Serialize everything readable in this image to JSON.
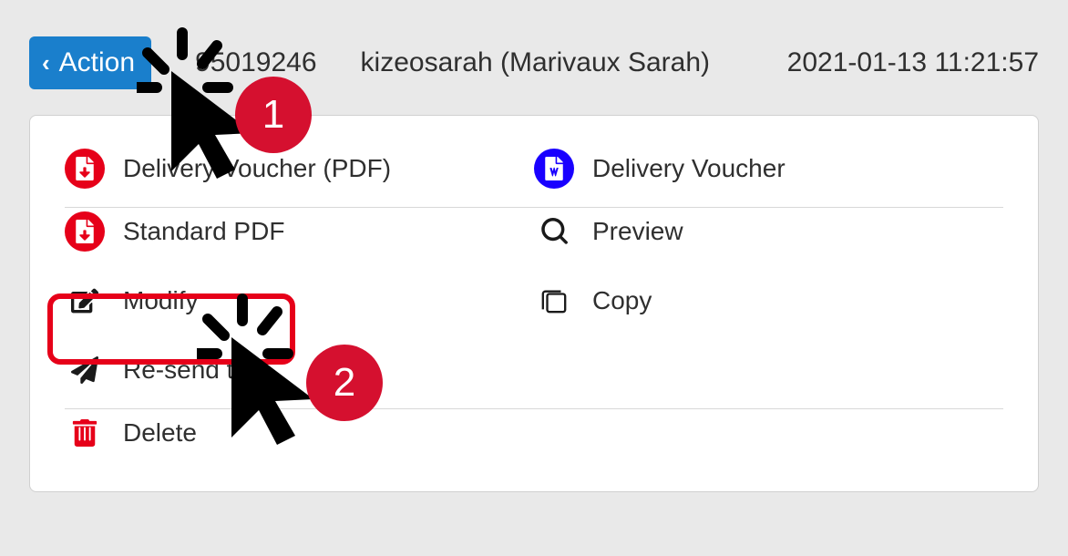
{
  "header": {
    "action_label": "Action",
    "record_id": "95019246",
    "user": "kizeosarah (Marivaux Sarah)",
    "timestamp": "2021-01-13 11:21:57"
  },
  "menu": {
    "delivery_pdf": "Delivery Voucher (PDF)",
    "delivery_doc": "Delivery Voucher",
    "standard_pdf": "Standard PDF",
    "preview": "Preview",
    "modify": "Modify",
    "copy": "Copy",
    "resend": "Re-send the",
    "delete": "Delete"
  },
  "annotations": {
    "badge1": "1",
    "badge2": "2"
  }
}
